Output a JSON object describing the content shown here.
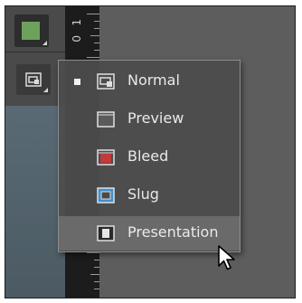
{
  "toolbar": {
    "fill_color": "#6da25c",
    "fill_icon": "fill-swatch-icon",
    "screen_mode_icon": "screen-mode-icon"
  },
  "ruler": {
    "labels": [
      "1",
      "0"
    ]
  },
  "screen_mode_menu": {
    "items": [
      {
        "label": "Normal",
        "icon": "normal-mode-icon",
        "checked": true
      },
      {
        "label": "Preview",
        "icon": "preview-mode-icon",
        "checked": false
      },
      {
        "label": "Bleed",
        "icon": "bleed-mode-icon",
        "checked": false
      },
      {
        "label": "Slug",
        "icon": "slug-mode-icon",
        "checked": false
      },
      {
        "label": "Presentation",
        "icon": "presentation-mode-icon",
        "checked": false,
        "hovered": true
      }
    ]
  },
  "colors": {
    "bleed_accent": "#c23a3a",
    "slug_accent": "#3f8fd0",
    "menu_highlight": "#6a6a6a"
  }
}
